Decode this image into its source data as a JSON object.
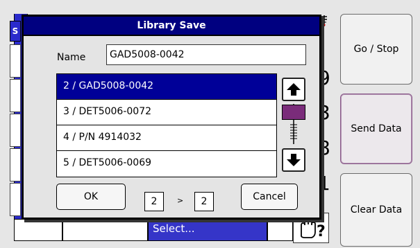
{
  "background": {
    "left_tab_letter": "S",
    "digits": [
      "9",
      "3",
      "8",
      "1"
    ],
    "select_label": "Select...",
    "help_icon": "hand-question-icon",
    "top_icon": "scale-icon"
  },
  "side_buttons": [
    {
      "label": "Go / Stop"
    },
    {
      "label": "Send Data"
    },
    {
      "label": "Clear Data"
    }
  ],
  "dialog": {
    "title": "Library Save",
    "name_label": "Name",
    "name_value": "GAD5008-0042",
    "items": [
      {
        "label": "2 / GAD5008-0042",
        "selected": true
      },
      {
        "label": "3 / DET5006-0072",
        "selected": false
      },
      {
        "label": "4 / P/N 4914032",
        "selected": false
      },
      {
        "label": "5 / DET5006-0069",
        "selected": false
      }
    ],
    "scroll_up_icon": "arrow-up-icon",
    "scroll_down_icon": "arrow-down-icon",
    "ok_label": "OK",
    "from_value": "2",
    "separator": ">",
    "to_value": "2",
    "cancel_label": "Cancel"
  },
  "colors": {
    "title_bar": "#000080",
    "selected_row": "#000098",
    "scroll_thumb": "#7a2c7a",
    "select_bar": "#3535c8"
  }
}
